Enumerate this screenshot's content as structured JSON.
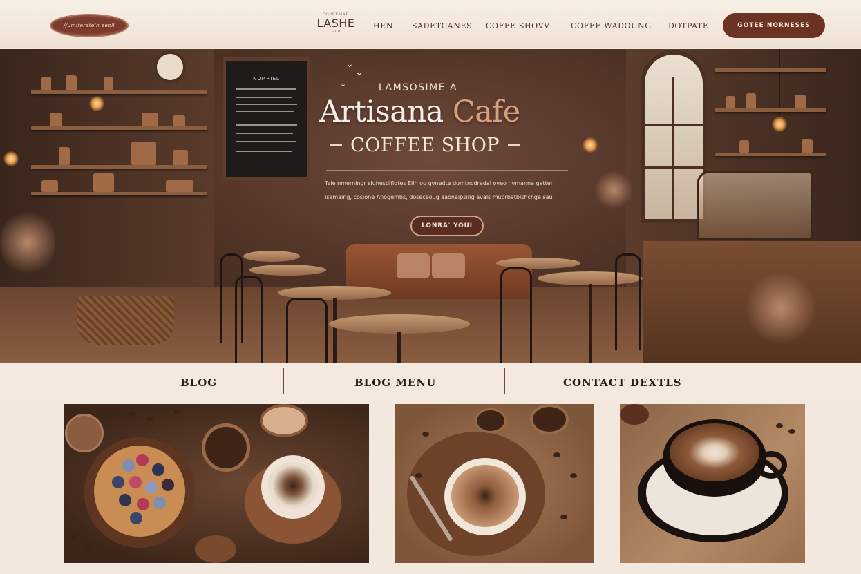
{
  "header": {
    "logo_text": "//umiterateln eeoll",
    "brand": {
      "small": "COPPEMAB",
      "main": "LASHE",
      "sub": "HUB"
    },
    "nav": [
      {
        "label": "HEN"
      },
      {
        "label": "SADETCANES"
      },
      {
        "label": "COFFE SHOVV"
      },
      {
        "label": "COFEE WADOUNG"
      },
      {
        "label": "DOTPATE"
      }
    ],
    "cta_label": "GOTEE NORNESES"
  },
  "hero": {
    "kicker": "LAMSOSIME A",
    "title_main": "Artisana ",
    "title_accent": "Cafe",
    "subtitle": "COFFEE SHOP",
    "description_lines": [
      "Tele nmerningr sluhesdiflotes Elih ou qvnedte domtncdradal oveo nvmanna gatten",
      "Isamaing, cosione Anogembs, doseceoug aaonaipsing avals muorbatblshchge sautmheudin"
    ],
    "button_label": "LONRA' YOUI",
    "chalkboard_title": "NUMRIEL"
  },
  "sections": [
    {
      "label": "BLOG"
    },
    {
      "label": "BLOG  MENU"
    },
    {
      "label": "CONTACT DEXTLS"
    }
  ],
  "colors": {
    "accent": "#6b3324",
    "background": "#f3e8dd",
    "title_accent": "#d8a07f"
  }
}
